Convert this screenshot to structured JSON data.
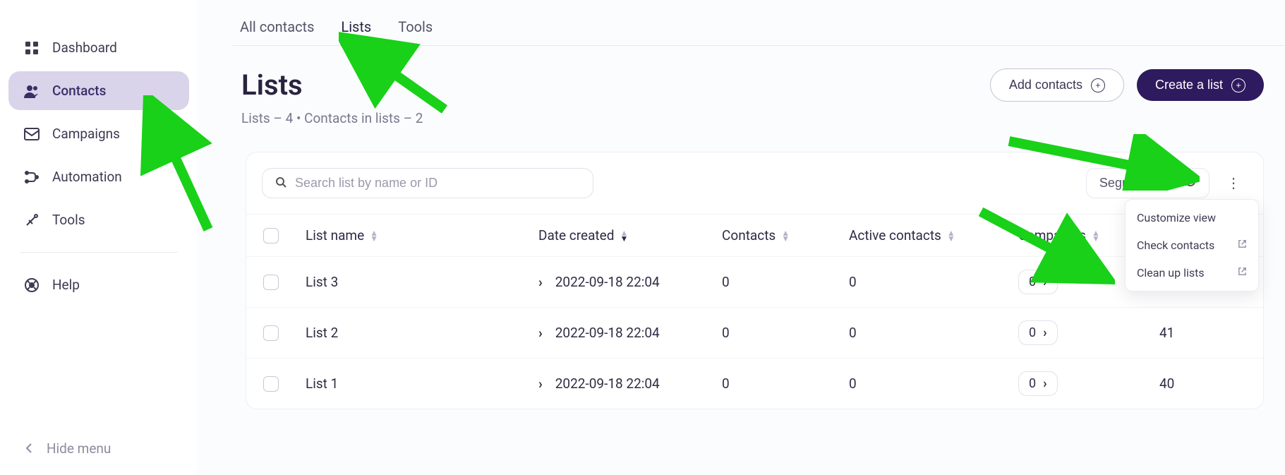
{
  "sidebar": {
    "items": [
      {
        "label": "Dashboard"
      },
      {
        "label": "Contacts"
      },
      {
        "label": "Campaigns"
      },
      {
        "label": "Automation"
      },
      {
        "label": "Tools"
      }
    ],
    "help": "Help",
    "hide": "Hide menu"
  },
  "tabs": {
    "all_contacts": "All contacts",
    "lists": "Lists",
    "tools": "Tools"
  },
  "page": {
    "title": "Lists",
    "subtitle": "Lists – 4 • Contacts in lists – 2"
  },
  "actions": {
    "add_contacts": "Add contacts",
    "create_list": "Create a list"
  },
  "search": {
    "placeholder": "Search list by name or ID"
  },
  "segmentation_label": "Segmentation",
  "columns": {
    "list_name": "List name",
    "date_created": "Date created",
    "contacts": "Contacts",
    "active_contacts": "Active contacts",
    "campaigns": "Campaigns"
  },
  "rows": [
    {
      "name": "List 3",
      "date": "2022-09-18 22:04",
      "contacts": "0",
      "active": "0",
      "campaigns": "0",
      "extra": ""
    },
    {
      "name": "List 2",
      "date": "2022-09-18 22:04",
      "contacts": "0",
      "active": "0",
      "campaigns": "0",
      "extra": "41"
    },
    {
      "name": "List 1",
      "date": "2022-09-18 22:04",
      "contacts": "0",
      "active": "0",
      "campaigns": "0",
      "extra": "40"
    }
  ],
  "popup": {
    "customize": "Customize view",
    "check": "Check contacts",
    "cleanup": "Clean up lists"
  }
}
